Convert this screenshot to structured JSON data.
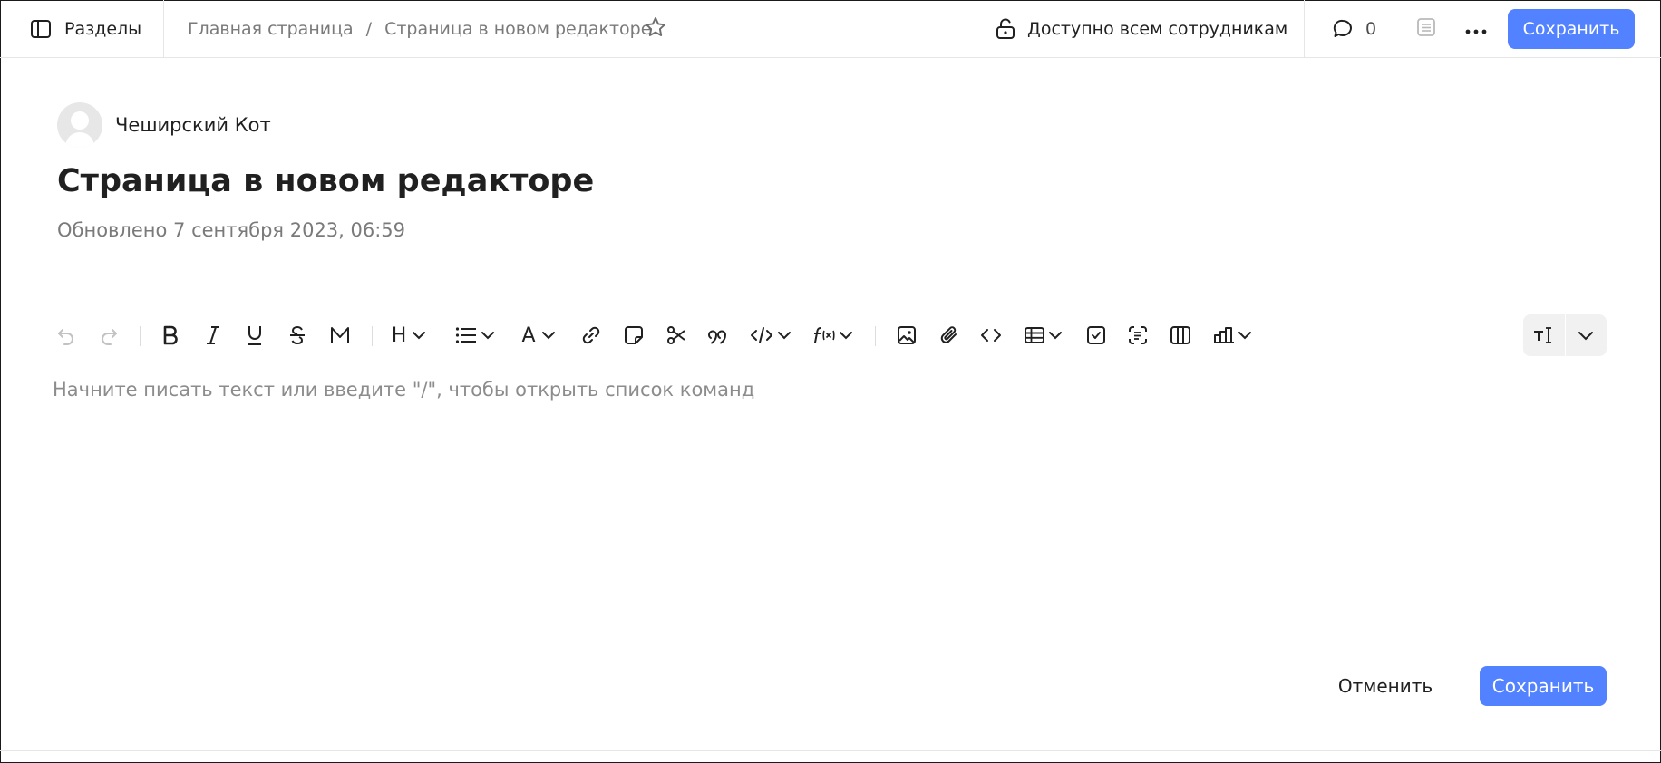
{
  "header": {
    "sections_label": "Разделы",
    "breadcrumbs": [
      {
        "label": "Главная страница"
      },
      {
        "label": "Страница в новом редакторе"
      }
    ],
    "breadcrumb_separator": "/",
    "access_label": "Доступно всем сотрудникам",
    "comments_count": "0",
    "save_label": "Сохранить"
  },
  "page": {
    "author_name": "Чеширский Кот",
    "title": "Страница в новом редакторе",
    "updated": "Обновлено 7 сентября 2023, 06:59"
  },
  "toolbar": {
    "heading_label": "H",
    "text_color_label": "A",
    "items": [
      "undo-icon",
      "redo-icon",
      "bold-icon",
      "italic-icon",
      "underline-icon",
      "strikethrough-icon",
      "mark-icon",
      "heading-icon",
      "list-icon",
      "text-color-icon",
      "link-icon",
      "note-icon",
      "cut-icon",
      "quote-icon",
      "code-icon",
      "formula-icon",
      "image-icon",
      "attachment-icon",
      "code-block-icon",
      "table-icon",
      "checkbox-icon",
      "yfm-block-icon",
      "columns-icon",
      "chart-icon",
      "text-format-icon",
      "chevron-down-icon"
    ]
  },
  "editor": {
    "placeholder": "Начните писать текст или введите \"/\", чтобы открыть список команд"
  },
  "footer": {
    "cancel_label": "Отменить",
    "save_label": "Сохранить"
  },
  "colors": {
    "accent": "#5282ff",
    "text": "#202020",
    "muted": "#7a7a7a",
    "divider": "#e6e6e6"
  }
}
